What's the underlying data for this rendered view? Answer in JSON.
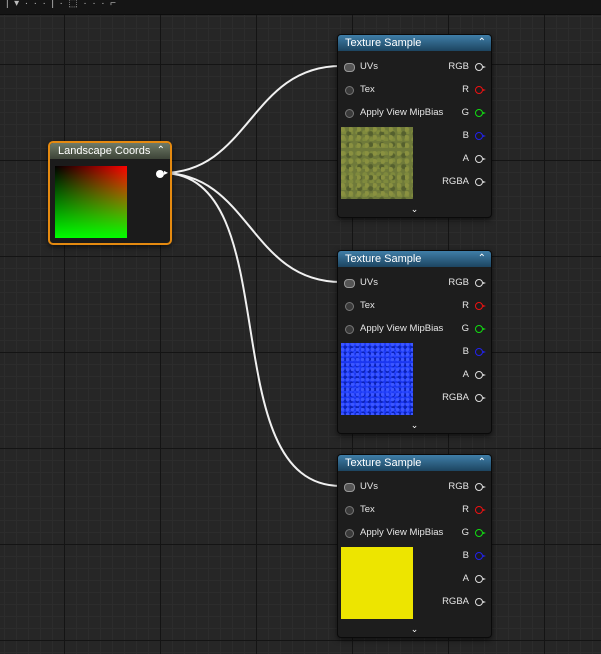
{
  "top_strip": {
    "text": "|  ▾  ·  ·  ·  |  ·  ⬚  ·  ·  ·  ⌐"
  },
  "colors": {
    "header_texture": "#2b6d96",
    "header_landscape": "#5a6450",
    "selection_border": "#e58a10",
    "pin_red": "#ee1111",
    "pin_green": "#11dd11",
    "pin_blue": "#2222ee",
    "wire": "#ffffff"
  },
  "landscape_node": {
    "title": "Landscape Coords",
    "collapse_icon": "chevron-up-icon"
  },
  "texture_nodes": [
    {
      "title": "Texture Sample",
      "inputs": [
        "UVs",
        "Tex",
        "Apply View MipBias"
      ],
      "outputs": [
        "RGB",
        "R",
        "G",
        "B",
        "A",
        "RGBA"
      ],
      "preview": "moss-texture"
    },
    {
      "title": "Texture Sample",
      "inputs": [
        "UVs",
        "Tex",
        "Apply View MipBias"
      ],
      "outputs": [
        "RGB",
        "R",
        "G",
        "B",
        "A",
        "RGBA"
      ],
      "preview": "blue-noise-texture"
    },
    {
      "title": "Texture Sample",
      "inputs": [
        "UVs",
        "Tex",
        "Apply View MipBias"
      ],
      "outputs": [
        "RGB",
        "R",
        "G",
        "B",
        "A",
        "RGBA"
      ],
      "preview": "yellow-texture"
    }
  ]
}
